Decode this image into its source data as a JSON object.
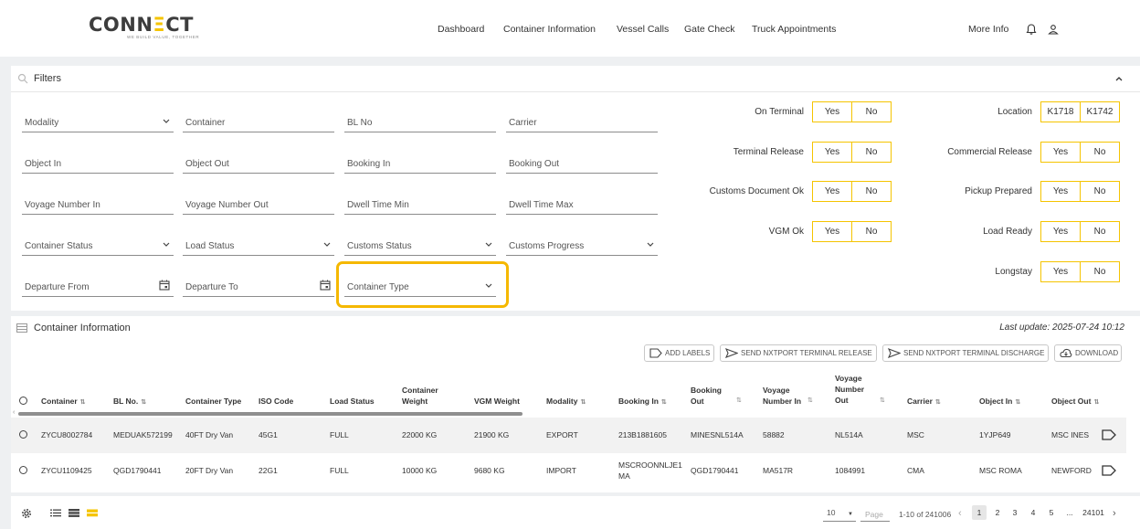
{
  "header": {
    "logo_pre": "CONN",
    "logo_accent": "Ξ",
    "logo_post": "CT",
    "logo_tagline": "WE BUILD VALUE, TOGETHER",
    "nav": [
      "Dashboard",
      "Container Information",
      "Vessel Calls",
      "Gate Check",
      "Truck Appointments"
    ],
    "more_info": "More Info",
    "icons": [
      "bell-icon",
      "user-icon"
    ]
  },
  "filters": {
    "title": "Filters",
    "fields": {
      "modality": "Modality",
      "container": "Container",
      "bl_no": "BL No",
      "carrier": "Carrier",
      "object_in": "Object In",
      "object_out": "Object Out",
      "booking_in": "Booking In",
      "booking_out": "Booking Out",
      "voyage_in": "Voyage Number In",
      "voyage_out": "Voyage Number Out",
      "dwell_min": "Dwell Time Min",
      "dwell_max": "Dwell Time Max",
      "container_status": "Container Status",
      "load_status": "Load Status",
      "customs_status": "Customs Status",
      "customs_progress": "Customs Progress",
      "departure_from": "Departure From",
      "departure_to": "Departure To",
      "container_type": "Container Type"
    },
    "toggles": {
      "on_terminal": "On Terminal",
      "terminal_release": "Terminal Release",
      "customs_doc_ok": "Customs Document Ok",
      "vgm_ok": "VGM Ok",
      "location": "Location",
      "commercial_release": "Commercial Release",
      "pickup_prepared": "Pickup Prepared",
      "load_ready": "Load Ready",
      "longstay": "Longstay",
      "yes": "Yes",
      "no": "No",
      "loc_a": "K1718",
      "loc_b": "K1742"
    }
  },
  "container_info": {
    "title": "Container Information",
    "last_update": "Last update: 2025-07-24 10:12",
    "actions": [
      "ADD LABELS",
      "SEND NXTPORT TERMINAL RELEASE",
      "SEND NXTPORT TERMINAL DISCHARGE",
      "DOWNLOAD"
    ],
    "columns": {
      "container": "Container",
      "bl_no": "BL No.",
      "container_type": "Container Type",
      "iso_code": "ISO Code",
      "load_status": "Load Status",
      "container_weight": "Container Weight",
      "vgm_weight": "VGM Weight",
      "modality": "Modality",
      "booking_in": "Booking In",
      "booking_out": "Booking Out",
      "voyage_in": "Voyage Number In",
      "voyage_out": "Voyage Number Out",
      "carrier": "Carrier",
      "object_in": "Object In",
      "object_out": "Object Out"
    },
    "rows": [
      {
        "container": "ZYCU8002784",
        "bl_no": "MEDUAK572199",
        "container_type": "40FT Dry Van",
        "iso_code": "45G1",
        "load_status": "FULL",
        "container_weight": "22000 KG",
        "vgm_weight": "21900 KG",
        "modality": "EXPORT",
        "booking_in": "213B1881605",
        "booking_out": "MINESNL514A",
        "voyage_in": "58882",
        "voyage_out": "NL514A",
        "carrier": "MSC",
        "object_in": "1YJP649",
        "object_out": "MSC INES"
      },
      {
        "container": "ZYCU1109425",
        "bl_no": "QGD1790441",
        "container_type": "20FT Dry Van",
        "iso_code": "22G1",
        "load_status": "FULL",
        "container_weight": "10000 KG",
        "vgm_weight": "9680 KG",
        "modality": "IMPORT",
        "booking_in_1": "MSCROONNLJE1",
        "booking_in_2": "MA",
        "booking_out": "QGD1790441",
        "voyage_in": "MA517R",
        "voyage_out": "1084991",
        "carrier": "CMA",
        "object_in": "MSC ROMA",
        "object_out": "NEWFORD"
      }
    ]
  },
  "pagination": {
    "page_size": "10",
    "page_placeholder": "Page",
    "range": "1-10 of 241006",
    "pages": [
      "1",
      "2",
      "3",
      "4",
      "5"
    ],
    "ellipsis": "...",
    "last_page": "24101"
  }
}
